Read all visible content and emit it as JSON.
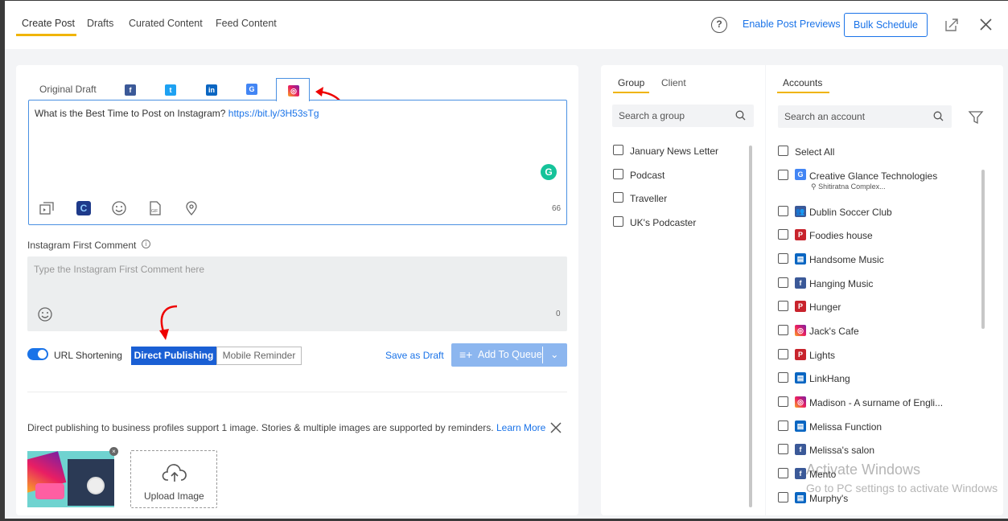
{
  "tabs": [
    "Create Post",
    "Drafts",
    "Curated Content",
    "Feed Content"
  ],
  "header": {
    "help": "?",
    "enable_previews": "Enable Post Previews",
    "bulk_schedule": "Bulk Schedule"
  },
  "platform_tabs": {
    "original": "Original Draft"
  },
  "editor": {
    "text": "What is the Best Time to Post on Instagram?",
    "link": "https://bit.ly/3H53sTg",
    "char_count": "66"
  },
  "first_comment": {
    "label": "Instagram First Comment",
    "placeholder": "Type the Instagram First Comment here",
    "count": "0"
  },
  "options": {
    "url_shortening": "URL Shortening",
    "direct_publishing": "Direct Publishing",
    "mobile_reminder": "Mobile Reminder",
    "save_draft": "Save as Draft",
    "add_to_queue": "Add To Queue"
  },
  "notice": {
    "text": "Direct publishing to business profiles support 1 image. Stories & multiple images are supported by reminders.",
    "learn_more": "Learn More"
  },
  "upload": {
    "label": "Upload Image"
  },
  "groups": {
    "tab_group": "Group",
    "tab_client": "Client",
    "search": "Search a group",
    "items": [
      "January News Letter",
      "Podcast",
      "Traveller",
      "UK's Podcaster"
    ]
  },
  "accounts": {
    "tab": "Accounts",
    "search": "Search an account",
    "select_all": "Select All",
    "items": [
      {
        "name": "Creative Glance Technologies",
        "sub": "Shitiratna Complex...",
        "icon": "google-business",
        "color": "#4285f4"
      },
      {
        "name": "Dublin Soccer Club",
        "icon": "facebook-group",
        "color": "#3b5998"
      },
      {
        "name": "Foodies house",
        "icon": "pinterest",
        "color": "#c8232c"
      },
      {
        "name": "Handsome Music",
        "icon": "linkedin-page",
        "color": "#0a66c2"
      },
      {
        "name": "Hanging Music",
        "icon": "facebook",
        "color": "#3b5998"
      },
      {
        "name": "Hunger",
        "icon": "pinterest",
        "color": "#c8232c"
      },
      {
        "name": "Jack's Cafe",
        "icon": "instagram",
        "color": "#d6249f"
      },
      {
        "name": "Lights",
        "icon": "pinterest",
        "color": "#c8232c"
      },
      {
        "name": "LinkHang",
        "icon": "linkedin-page",
        "color": "#0a66c2"
      },
      {
        "name": "Madison - A surname of Engli...",
        "icon": "instagram",
        "color": "#d6249f"
      },
      {
        "name": "Melissa Function",
        "icon": "linkedin-page",
        "color": "#0a66c2"
      },
      {
        "name": "Melissa's salon",
        "icon": "facebook",
        "color": "#3b5998"
      },
      {
        "name": "Mento",
        "icon": "facebook",
        "color": "#3b5998"
      },
      {
        "name": "Murphy's",
        "icon": "linkedin-page",
        "color": "#0a66c2"
      }
    ]
  },
  "watermark": {
    "line1": "Activate Windows",
    "line2": "Go to PC settings to activate Windows"
  }
}
